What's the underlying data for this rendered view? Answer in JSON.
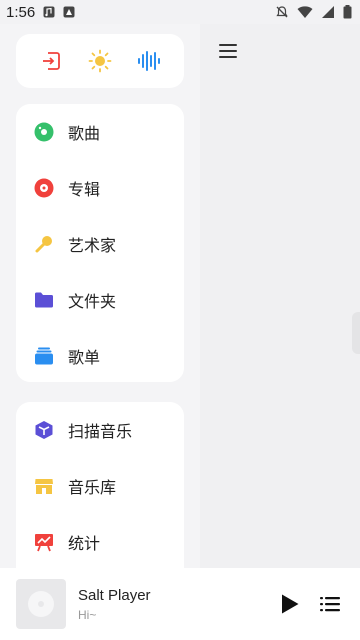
{
  "status": {
    "time": "1:56"
  },
  "colors": {
    "songs": "#35c06b",
    "albums": "#f0413c",
    "artists": "#f5c542",
    "folders": "#5b4fd6",
    "playlists": "#2a8ef0",
    "scan": "#5b4fd6",
    "library": "#f5c542",
    "stats": "#f0413c",
    "quick_exit": "#f0413c",
    "quick_sun": "#f5c542",
    "quick_eq": "#2a8ef0"
  },
  "quick_actions": [
    {
      "name": "exit-icon"
    },
    {
      "name": "sun-icon"
    },
    {
      "name": "equalizer-icon"
    }
  ],
  "library_menu": {
    "items": [
      {
        "label": "歌曲",
        "icon": "disc-icon"
      },
      {
        "label": "专辑",
        "icon": "album-icon"
      },
      {
        "label": "艺术家",
        "icon": "microphone-icon"
      },
      {
        "label": "文件夹",
        "icon": "folder-icon"
      },
      {
        "label": "歌单",
        "icon": "playlist-stack-icon"
      }
    ]
  },
  "tools_menu": {
    "items": [
      {
        "label": "扫描音乐",
        "icon": "scan-cube-icon"
      },
      {
        "label": "音乐库",
        "icon": "store-icon"
      },
      {
        "label": "统计",
        "icon": "chart-board-icon"
      }
    ]
  },
  "player": {
    "title": "Salt Player",
    "subtitle": "Hi~"
  }
}
